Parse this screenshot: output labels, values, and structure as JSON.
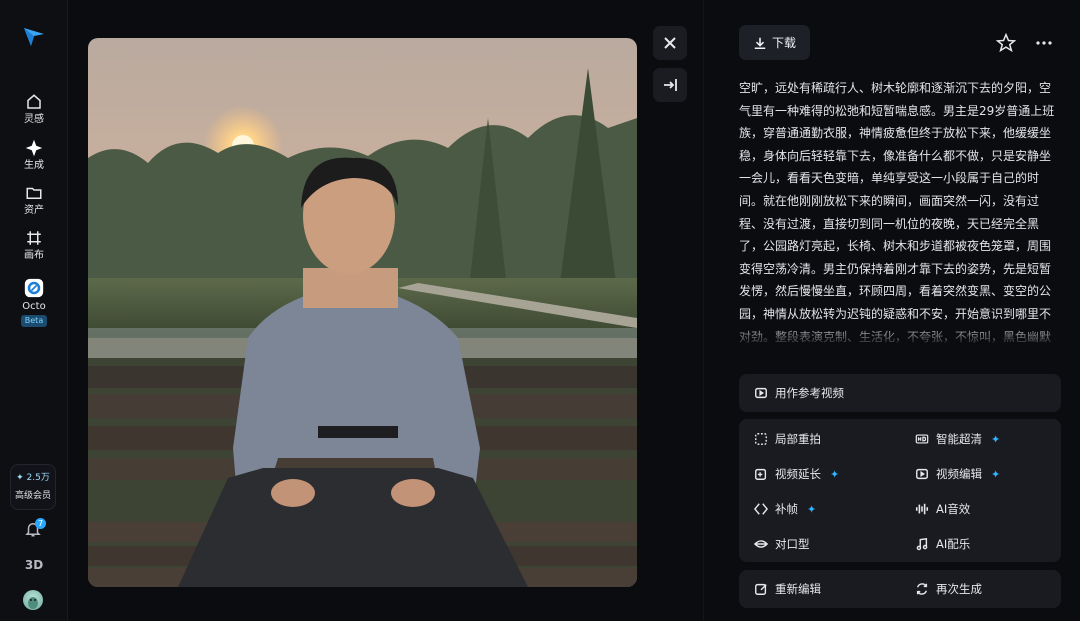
{
  "sidebar": {
    "items": [
      {
        "label": "灵感",
        "icon": "home-icon"
      },
      {
        "label": "生成",
        "icon": "sparkle-icon"
      },
      {
        "label": "资产",
        "icon": "folder-icon"
      },
      {
        "label": "画布",
        "icon": "canvas-icon"
      },
      {
        "label": "Octo",
        "icon": "octo-icon",
        "badge": "Beta"
      }
    ],
    "credits_amount": "2.5万",
    "membership": "高级会员",
    "notification_count": "7",
    "three_d_label": "3D"
  },
  "toolbar": {
    "download_label": "下载"
  },
  "prompt": {
    "text": "空旷，远处有稀疏行人、树木轮廓和逐渐沉下去的夕阳，空气里有一种难得的松弛和短暂喘息感。男主是29岁普通上班族，穿普通通勤衣服，神情疲惫但终于放松下来，他缓缓坐稳，身体向后轻轻靠下去，像准备什么都不做，只是安静坐一会儿，看看天色变暗，单纯享受这一小段属于自己的时间。就在他刚刚放松下来的瞬间，画面突然一闪，没有过程、没有过渡，直接切到同一机位的夜晚，天已经完全黑了，公园路灯亮起，长椅、树木和步道都被夜色笼罩，周围变得空荡冷清。男主仍保持着刚才靠下去的姿势，先是短暂发愣，然后慢慢坐直，环顾四周，看着突然变黑、变空的公园，神情从放松转为迟钝的疑惑和不安，开始意识到哪里不对劲。整段表演克制、生活化，不夸张，不惊叫，黑色幽默隐藏在一个普通人刚想歇一会儿、这段时间却被直接抹掉的"
  },
  "actions": {
    "reference": "用作参考视频",
    "retake": "局部重拍",
    "upscale": "智能超清",
    "extend": "视频延长",
    "edit": "视频编辑",
    "interpolate": "补帧",
    "sfx": "AI音效",
    "lipsync": "对口型",
    "music": "AI配乐",
    "reedit": "重新编辑",
    "regenerate": "再次生成"
  },
  "colors": {
    "accent": "#2fb4ff",
    "background": "#0b0c10",
    "card": "#1a1b21"
  }
}
